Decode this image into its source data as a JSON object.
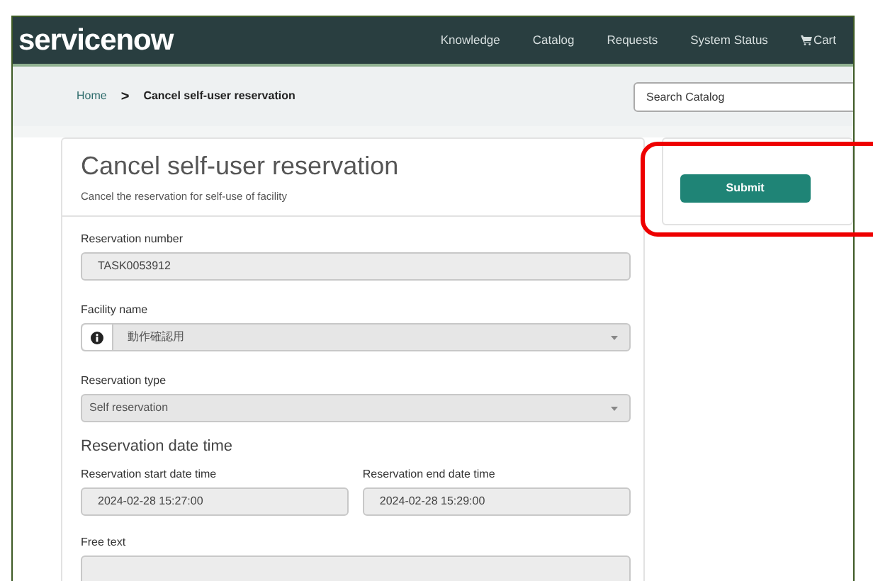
{
  "header": {
    "logo": "servicenow",
    "nav": [
      {
        "label": "Knowledge",
        "kind": "link"
      },
      {
        "label": "Catalog",
        "kind": "link"
      },
      {
        "label": "Requests",
        "kind": "link"
      },
      {
        "label": "System Status",
        "kind": "link"
      },
      {
        "label": "Cart",
        "kind": "cart"
      }
    ]
  },
  "breadcrumb": {
    "home": "Home",
    "separator": ">",
    "current": "Cancel self-user reservation"
  },
  "search": {
    "placeholder": "Search Catalog"
  },
  "form": {
    "title": "Cancel self-user reservation",
    "subtitle": "Cancel the reservation for self-use of facility",
    "fields": [
      {
        "kind": "text",
        "label": "Reservation number",
        "value": "TASK0053912"
      },
      {
        "kind": "select",
        "label": "Facility name",
        "value": "動作確認用",
        "info": true
      },
      {
        "kind": "select",
        "label": "Reservation type",
        "value": "Self reservation",
        "info": false
      },
      {
        "kind": "heading",
        "label": "Reservation date time"
      },
      {
        "kind": "pair",
        "items": [
          {
            "label": "Reservation start date time",
            "value": "2024-02-28 15:27:00"
          },
          {
            "label": "Reservation end date time",
            "value": "2024-02-28 15:29:00"
          }
        ]
      },
      {
        "kind": "textarea",
        "label": "Free text"
      }
    ]
  },
  "actions": {
    "submit": "Submit"
  },
  "annotation": {
    "highlight": true
  }
}
